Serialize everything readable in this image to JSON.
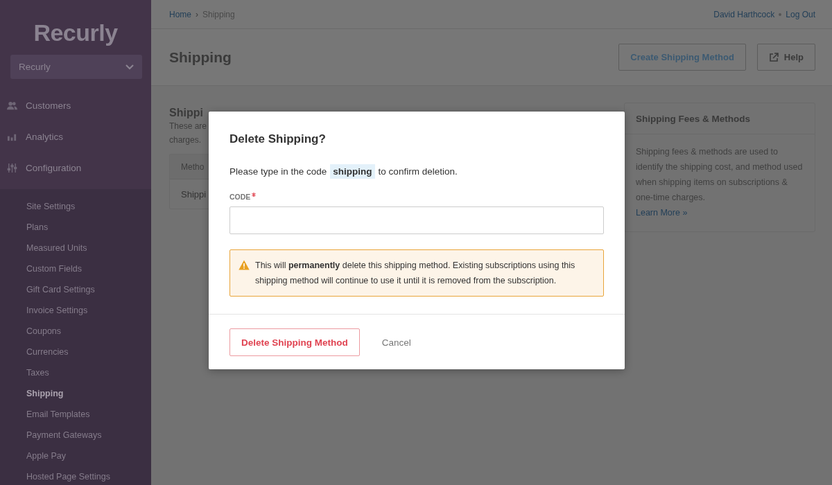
{
  "sidebar": {
    "logo": "Recurly",
    "site_selector": {
      "value": "Recurly"
    },
    "nav": [
      {
        "kind": "customers",
        "label": "Customers"
      },
      {
        "kind": "analytics",
        "label": "Analytics"
      },
      {
        "kind": "configuration",
        "label": "Configuration"
      }
    ],
    "sub_nav": [
      {
        "label": "Site Settings",
        "selected": false
      },
      {
        "label": "Plans",
        "selected": false
      },
      {
        "label": "Measured Units",
        "selected": false
      },
      {
        "label": "Custom Fields",
        "selected": false
      },
      {
        "label": "Gift Card Settings",
        "selected": false
      },
      {
        "label": "Invoice Settings",
        "selected": false
      },
      {
        "label": "Coupons",
        "selected": false
      },
      {
        "label": "Currencies",
        "selected": false
      },
      {
        "label": "Taxes",
        "selected": false
      },
      {
        "label": "Shipping",
        "selected": true
      },
      {
        "label": "Email Templates",
        "selected": false
      },
      {
        "label": "Payment Gateways",
        "selected": false
      },
      {
        "label": "Apple Pay",
        "selected": false
      },
      {
        "label": "Hosted Page Settings",
        "selected": false
      }
    ]
  },
  "topbar": {
    "breadcrumbs": [
      "Home",
      "Shipping"
    ],
    "separator": "›",
    "user": "David Harthcock",
    "logout": "Log Out"
  },
  "header": {
    "title": "Shipping",
    "buttons": [
      {
        "kind": "outline",
        "label": "Create Shipping Method"
      },
      {
        "kind": "help",
        "label": "Help"
      }
    ]
  },
  "content": {
    "section_title": "Shippi",
    "description": [
      "These are",
      "charges."
    ],
    "table": {
      "columns": [
        "Metho"
      ],
      "rows": [
        [
          "Shippi"
        ]
      ]
    }
  },
  "side_panel": {
    "title": "Shipping Fees & Methods",
    "body": "Shipping fees & methods are used to identify the shipping cost, and method used when shipping items on subscriptions & one-time charges.",
    "link": "Learn More »"
  },
  "modal": {
    "title": "Delete Shipping?",
    "instruction": {
      "before": "Please type in the code",
      "code": "shipping",
      "after": "to confirm deletion."
    },
    "field": {
      "label": "CODE",
      "required": true
    },
    "warning": "This will **permanently** delete this shipping method. Existing subscriptions using this shipping method will continue to use it until it is removed from the subscription.",
    "buttons": [
      {
        "kind": "danger",
        "label": "Delete Shipping Method"
      },
      {
        "kind": "link",
        "label": "Cancel"
      }
    ]
  }
}
